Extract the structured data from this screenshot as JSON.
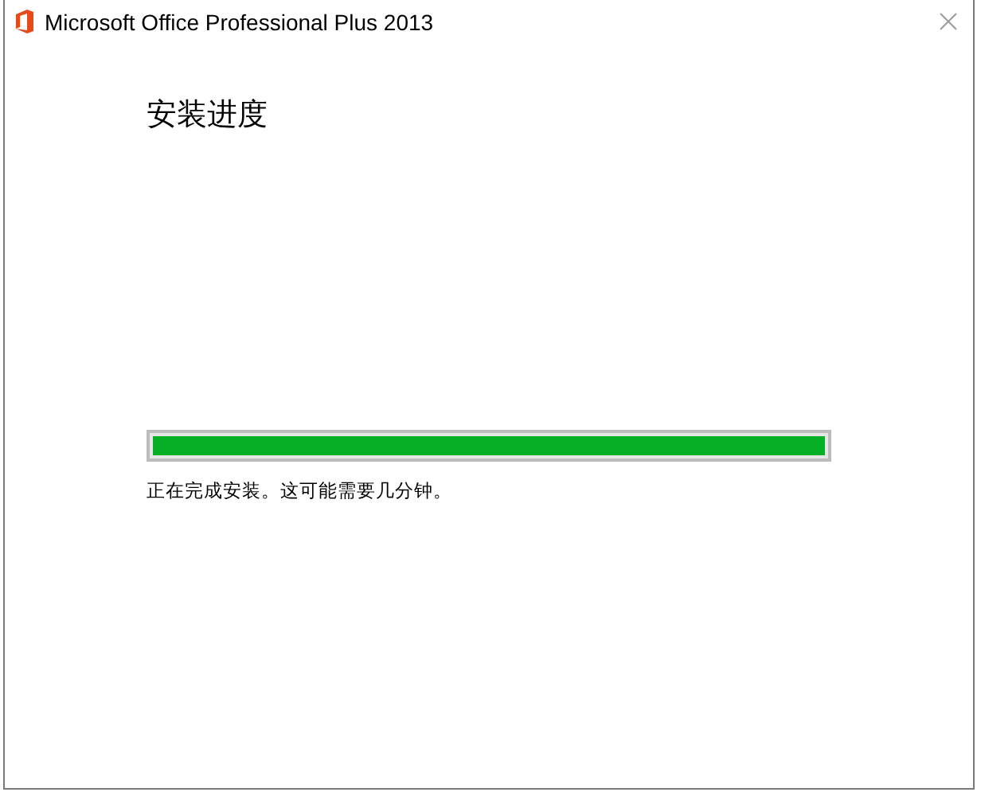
{
  "window": {
    "title": "Microsoft Office Professional Plus 2013"
  },
  "heading": "安装进度",
  "progress": {
    "level": 1
  },
  "status": "正在完成安装。这可能需要几分钟。"
}
